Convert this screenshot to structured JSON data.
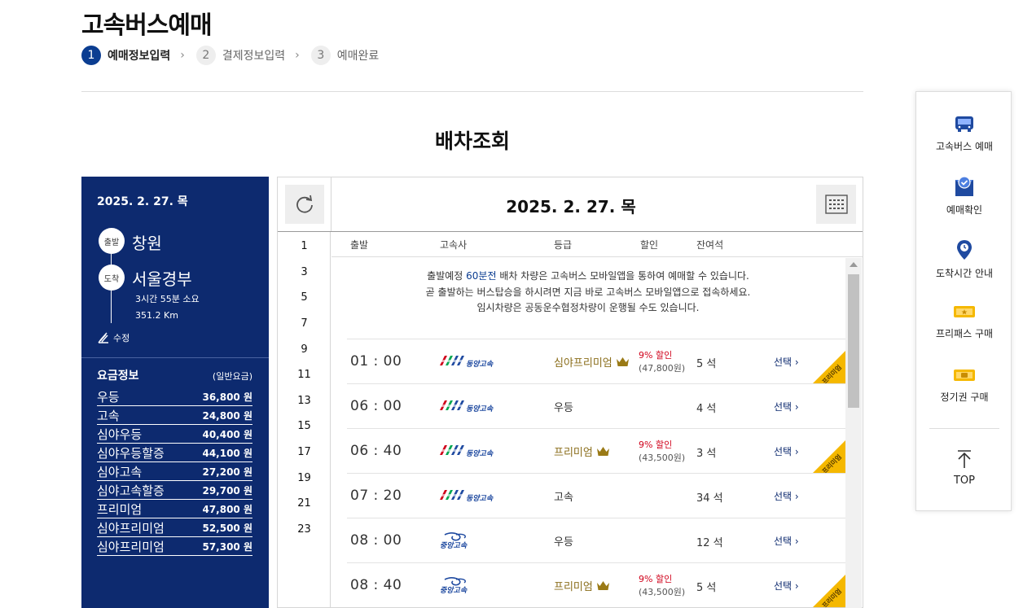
{
  "page": {
    "title": "고속버스예매",
    "steps": [
      {
        "num": "1",
        "label": "예매정보입력"
      },
      {
        "num": "2",
        "label": "결제정보입력"
      },
      {
        "num": "3",
        "label": "예매완료"
      }
    ],
    "section_title": "배차조회"
  },
  "left_panel": {
    "date": "2025. 2. 27. 목",
    "departure_badge": "출발",
    "departure": "창원",
    "arrival_badge": "도착",
    "arrival": "서울경부",
    "duration": "3시간 55분 소요",
    "distance": "351.2 Km",
    "edit_label": "수정",
    "fare_title": "요금정보",
    "fare_sub": "(일반요금)",
    "fares": [
      {
        "grade": "우등",
        "price": "36,800 원"
      },
      {
        "grade": "고속",
        "price": "24,800 원"
      },
      {
        "grade": "심야우등",
        "price": "40,400 원"
      },
      {
        "grade": "심야우등할증",
        "price": "44,100 원"
      },
      {
        "grade": "심야고속",
        "price": "27,200 원"
      },
      {
        "grade": "심야고속할증",
        "price": "29,700 원"
      },
      {
        "grade": "프리미엄",
        "price": "47,800 원"
      },
      {
        "grade": "심야프리미엄",
        "price": "52,500 원"
      },
      {
        "grade": "심야프리미엄",
        "price": "57,300 원"
      }
    ]
  },
  "table": {
    "date_title": "2025. 2. 27. 목",
    "hours": [
      "1",
      "3",
      "5",
      "7",
      "9",
      "11",
      "13",
      "15",
      "17",
      "19",
      "21",
      "23"
    ],
    "columns": {
      "depart": "출발",
      "company": "고속사",
      "grade": "등급",
      "discount": "할인",
      "seats": "잔여석"
    },
    "notice": {
      "line1_pre": "출발예정 ",
      "line1_hl": "60분전",
      "line1_post": " 배차 차량은 고속버스 모바일앱을 통하여 예매할 수 있습니다.",
      "line2": "곧 출발하는 버스탑승을 하시려면 지금 바로 고속버스 모바일앱으로 접속하세요.",
      "line3": "임시차량은 공동운수협정차량이 운행될 수도 있습니다."
    },
    "select_label": "선택",
    "ribbon_label": "프리미엄",
    "rows": [
      {
        "time": "01 : 00",
        "company": "동양고속",
        "grade": "심야프리미엄",
        "premium": true,
        "discount": "9% 할인",
        "discount_price": "(47,800원)",
        "seats": "5 석"
      },
      {
        "time": "06 : 00",
        "company": "동양고속",
        "grade": "우등",
        "premium": false,
        "discount": "",
        "discount_price": "",
        "seats": "4 석"
      },
      {
        "time": "06 : 40",
        "company": "동양고속",
        "grade": "프리미엄",
        "premium": true,
        "discount": "9% 할인",
        "discount_price": "(43,500원)",
        "seats": "3 석"
      },
      {
        "time": "07 : 20",
        "company": "동양고속",
        "grade": "고속",
        "premium": false,
        "discount": "",
        "discount_price": "",
        "seats": "34 석"
      },
      {
        "time": "08 : 00",
        "company": "중앙고속",
        "grade": "우등",
        "premium": false,
        "discount": "",
        "discount_price": "",
        "seats": "12 석"
      },
      {
        "time": "08 : 40",
        "company": "중앙고속",
        "grade": "프리미엄",
        "premium": true,
        "discount": "9% 할인",
        "discount_price": "(43,500원)",
        "seats": "5 석"
      }
    ]
  },
  "quick_menu": {
    "items": [
      {
        "label": "고속버스 예매",
        "icon": "bus-icon"
      },
      {
        "label": "예매확인",
        "icon": "ticket-check-icon"
      },
      {
        "label": "도착시간 안내",
        "icon": "location-pin-icon"
      },
      {
        "label": "프리패스 구매",
        "icon": "free-pass-icon"
      },
      {
        "label": "정기권 구매",
        "icon": "season-ticket-icon"
      }
    ],
    "top_label": "TOP"
  },
  "colors": {
    "brand_navy": "#0d2a6f",
    "accent_blue": "#0b3d91",
    "discount_red": "#d0021b",
    "premium_gold": "#f5b800"
  }
}
